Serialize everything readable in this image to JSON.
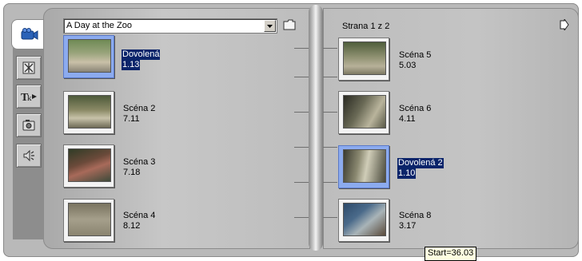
{
  "album": {
    "selected": "A Day at the Zoo"
  },
  "pagination": {
    "label": "Strana 1 z 2"
  },
  "tabs": [
    {
      "name": "video-scenes",
      "icon": "video-camera-icon",
      "active": true
    },
    {
      "name": "transitions",
      "icon": "transition-icon",
      "active": false
    },
    {
      "name": "titles",
      "icon": "title-icon",
      "active": false
    },
    {
      "name": "still-images",
      "icon": "camera-icon",
      "active": false
    },
    {
      "name": "sound-effects",
      "icon": "speaker-icon",
      "active": false
    }
  ],
  "scenes_left": [
    {
      "name": "Dovolená",
      "duration": "1.13",
      "selected": true
    },
    {
      "name": "Scéna 2",
      "duration": "7.11",
      "selected": false
    },
    {
      "name": "Scéna 3",
      "duration": "7.18",
      "selected": false
    },
    {
      "name": "Scéna 4",
      "duration": "8.12",
      "selected": false
    }
  ],
  "scenes_right": [
    {
      "name": "Scéna 5",
      "duration": "5.03",
      "selected": false
    },
    {
      "name": "Scéna 6",
      "duration": "4.11",
      "selected": false
    },
    {
      "name": "Dovolená 2",
      "duration": "1.10",
      "selected": true
    },
    {
      "name": "Scéna 8",
      "duration": "3.17",
      "selected": false
    }
  ],
  "tooltip": {
    "text": "Start=36.03"
  },
  "colors": {
    "selection": "#0a246a",
    "selected_thumb": "#8cabef"
  }
}
